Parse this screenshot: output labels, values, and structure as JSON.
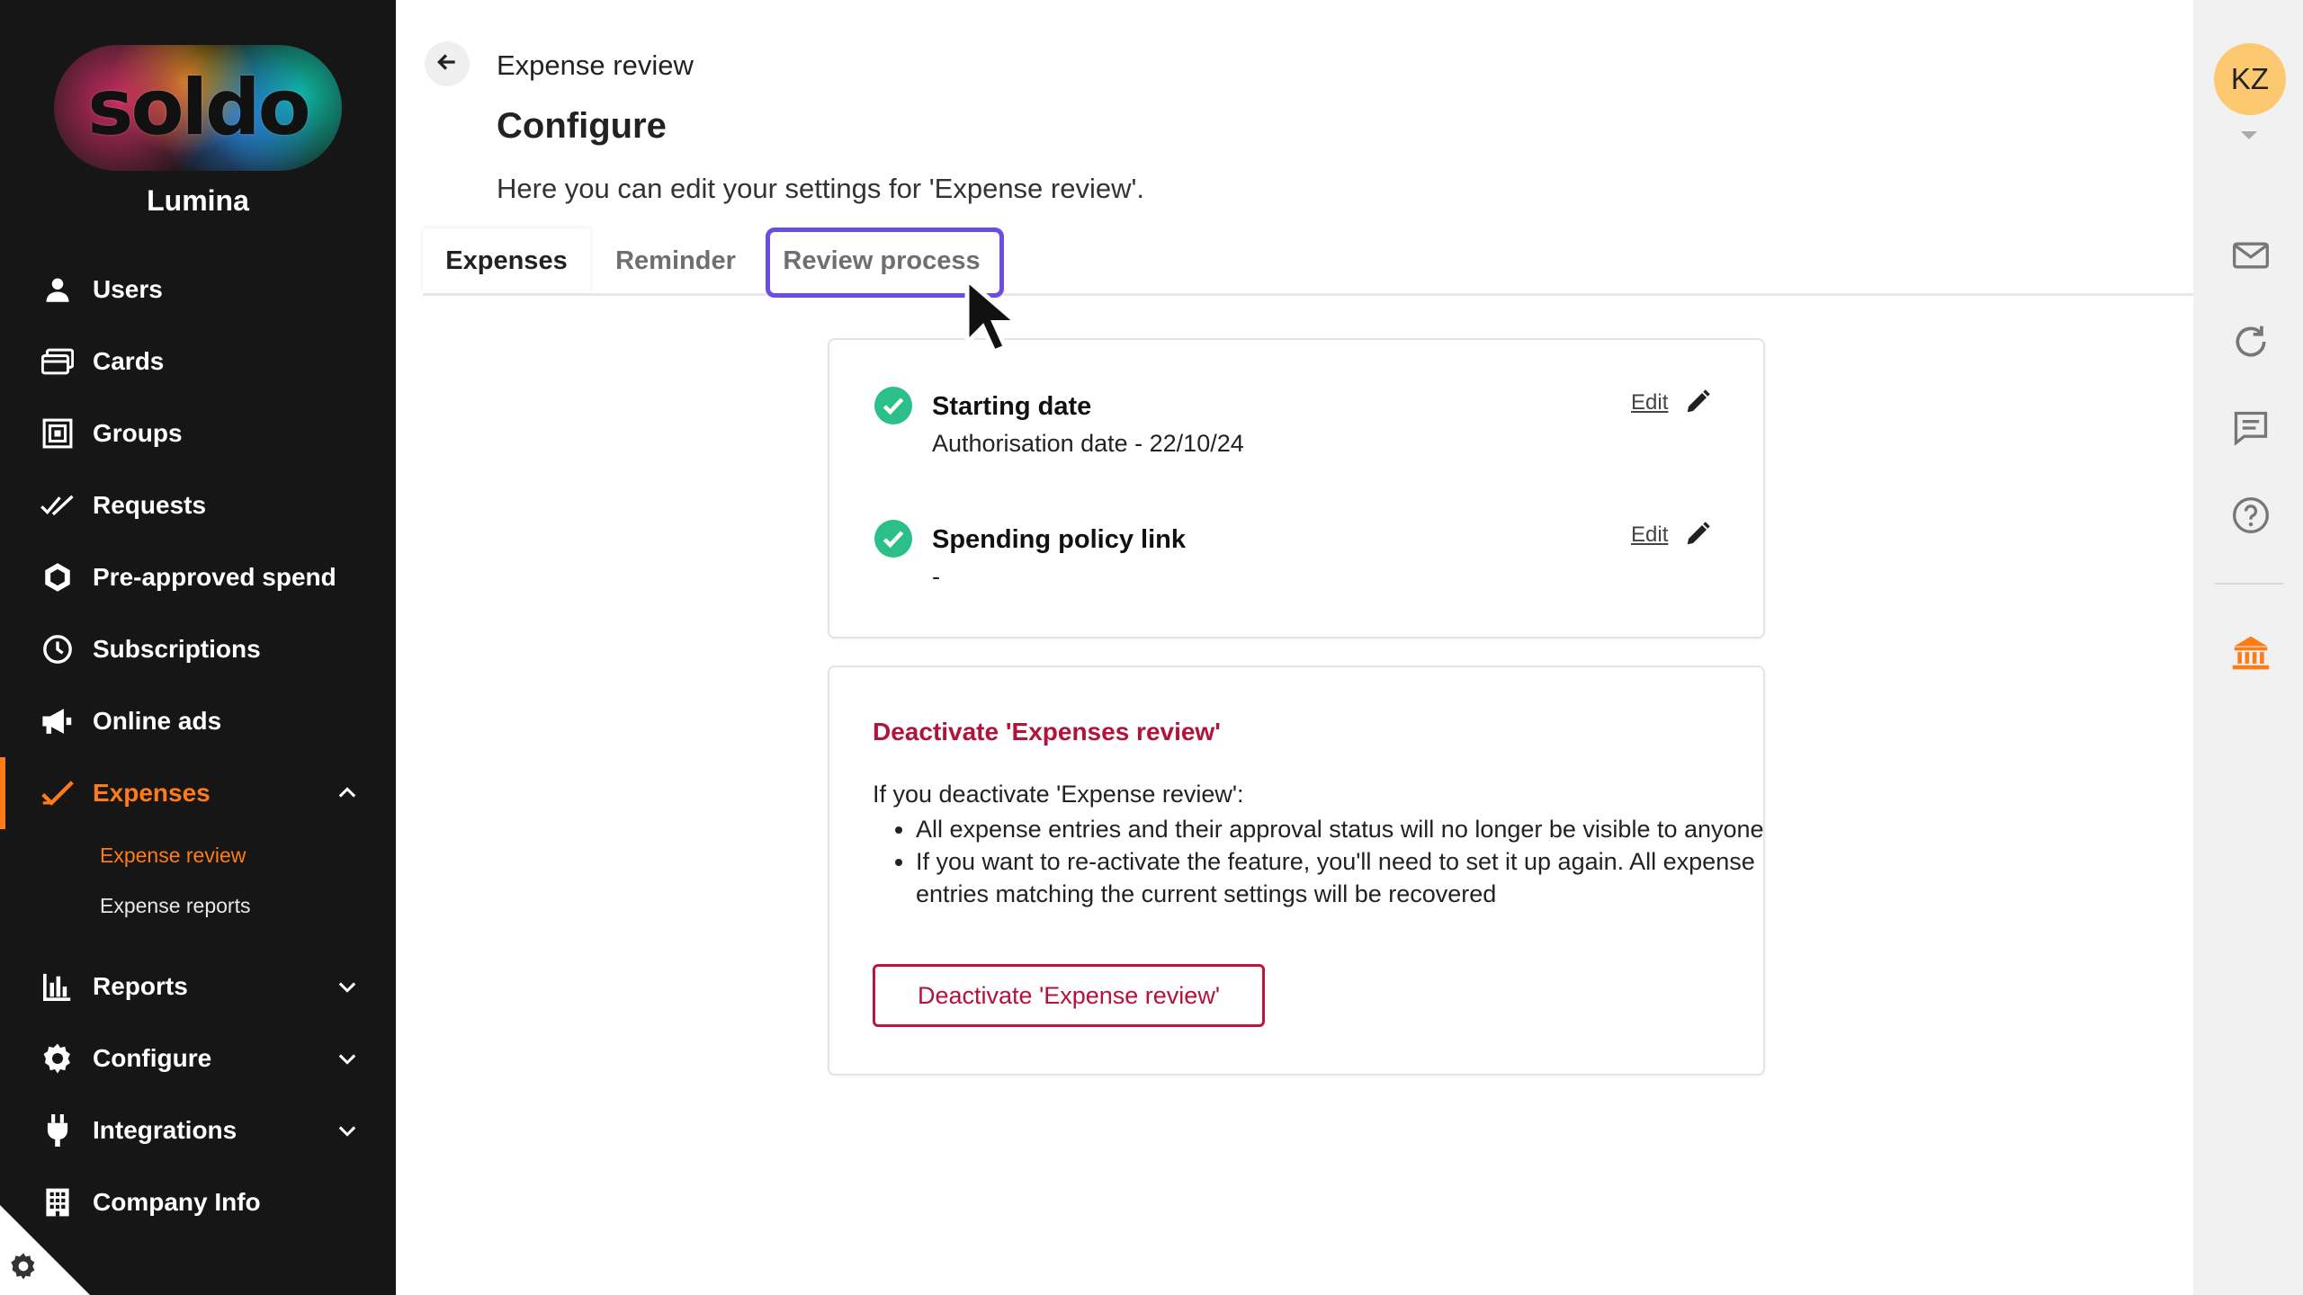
{
  "sidebar": {
    "logo_text": "soldo",
    "org_name": "Lumina",
    "items": [
      {
        "label": "Users",
        "icon": "user-icon"
      },
      {
        "label": "Cards",
        "icon": "cards-icon"
      },
      {
        "label": "Groups",
        "icon": "groups-icon"
      },
      {
        "label": "Requests",
        "icon": "double-check-icon"
      },
      {
        "label": "Pre-approved spend",
        "icon": "hexagon-icon"
      },
      {
        "label": "Subscriptions",
        "icon": "clock-icon"
      },
      {
        "label": "Online ads",
        "icon": "megaphone-icon"
      },
      {
        "label": "Expenses",
        "icon": "check-icon",
        "active": true,
        "expanded": true
      },
      {
        "label": "Reports",
        "icon": "bar-chart-icon"
      },
      {
        "label": "Configure",
        "icon": "gear-icon"
      },
      {
        "label": "Integrations",
        "icon": "plug-icon"
      },
      {
        "label": "Company Info",
        "icon": "building-icon"
      }
    ],
    "sub_items": [
      {
        "label": "Expense review",
        "active": true
      },
      {
        "label": "Expense reports"
      }
    ],
    "accent_color": "#ff7b17"
  },
  "header": {
    "breadcrumb": "Expense review",
    "title": "Configure",
    "subtitle": "Here you can edit your settings for 'Expense review'."
  },
  "tabs": [
    {
      "label": "Expenses",
      "active": true
    },
    {
      "label": "Reminder"
    },
    {
      "label": "Review process",
      "highlighted": true
    }
  ],
  "settings": {
    "items": [
      {
        "title": "Starting date",
        "value": "Authorisation date - 22/10/24",
        "edit_label": "Edit"
      },
      {
        "title": "Spending policy link",
        "value": "-",
        "edit_label": "Edit"
      }
    ],
    "status_color": "#2bbf8a"
  },
  "deactivate": {
    "title": "Deactivate 'Expenses review'",
    "intro": "If you deactivate 'Expense review':",
    "bullets": [
      "All expense entries and their approval status will no longer be visible to anyone",
      "If you want to re-activate the feature, you'll need to set it up again. All expense entries matching the current settings will be recovered"
    ],
    "button_label": "Deactivate 'Expense review'",
    "color": "#b3123a"
  },
  "rail": {
    "avatar_initials": "KZ",
    "icons": [
      "mail-icon",
      "refresh-icon",
      "chat-icon",
      "help-icon",
      "bank-icon"
    ]
  }
}
